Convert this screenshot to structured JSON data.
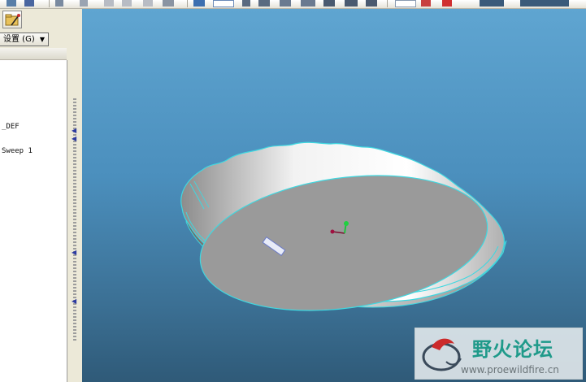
{
  "toolbar": {
    "icons": [
      "window-icon",
      "save-icon",
      "undo-icon",
      "redo-icon",
      "copy-icon",
      "paste-icon",
      "cut-icon",
      "regenerate-icon",
      "layers-icon",
      "selection-icon",
      "zoom-icon",
      "zoom-box-icon",
      "orient-icon",
      "views-icon",
      "shade-icon",
      "datum-icon",
      "repaint-icon",
      "display-style-icon",
      "axis-display-icon",
      "point-display-icon",
      "csys-display-icon",
      "annotation-display-icon"
    ]
  },
  "left_panel": {
    "settings_label": "设置 (G)",
    "tree_items": [
      "_DEF",
      "Sweep 1"
    ]
  },
  "viewport": {
    "colors": {
      "background_top": "#5fa5d1",
      "background_bottom": "#2f5a78",
      "part_body": "#9a9a9a",
      "edge_highlight": "#3fd8e0"
    }
  },
  "watermark": {
    "title": "野火论坛",
    "url": "www.proewildfire.cn"
  }
}
